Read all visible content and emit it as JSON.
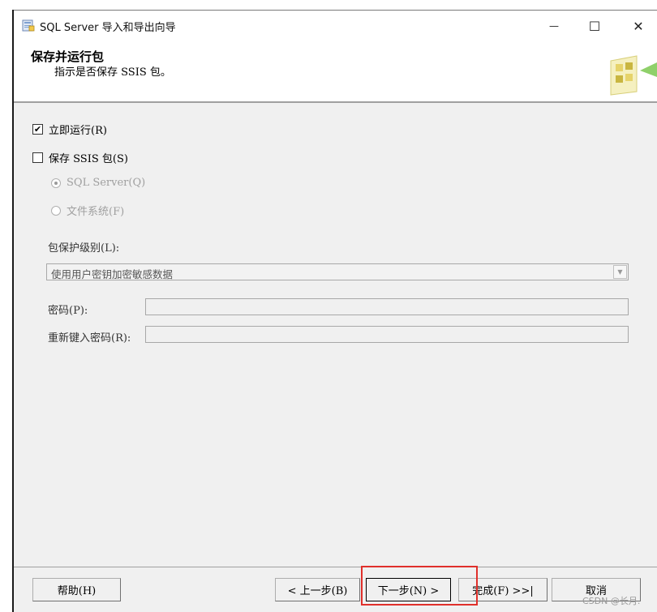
{
  "window": {
    "title": "SQL Server 导入和导出向导",
    "minimize_glyph": "—",
    "maximize_glyph": "☐",
    "close_glyph": "✕"
  },
  "header": {
    "title": "保存并运行包",
    "subtitle": "指示是否保存 SSIS 包。"
  },
  "options": {
    "run_now": {
      "label": "立即运行(R)",
      "checked": true
    },
    "save_ssis": {
      "label": "保存 SSIS 包(S)",
      "checked": false
    },
    "sql_server": {
      "label": "SQL Server(Q)",
      "selected": true,
      "enabled": false
    },
    "file_system": {
      "label": "文件系统(F)",
      "selected": false,
      "enabled": false
    }
  },
  "protection": {
    "label": "包保护级别(L):",
    "selected": "使用用户密钥加密敏感数据"
  },
  "password": {
    "label": "密码(P):",
    "value": ""
  },
  "retype_password": {
    "label": "重新键入密码(R):",
    "value": ""
  },
  "buttons": {
    "help": "帮助(H)",
    "back": "< 上一步(B)",
    "next": "下一步(N) >",
    "finish": "完成(F) >>|",
    "cancel": "取消"
  },
  "watermark": "CSDN @长月."
}
